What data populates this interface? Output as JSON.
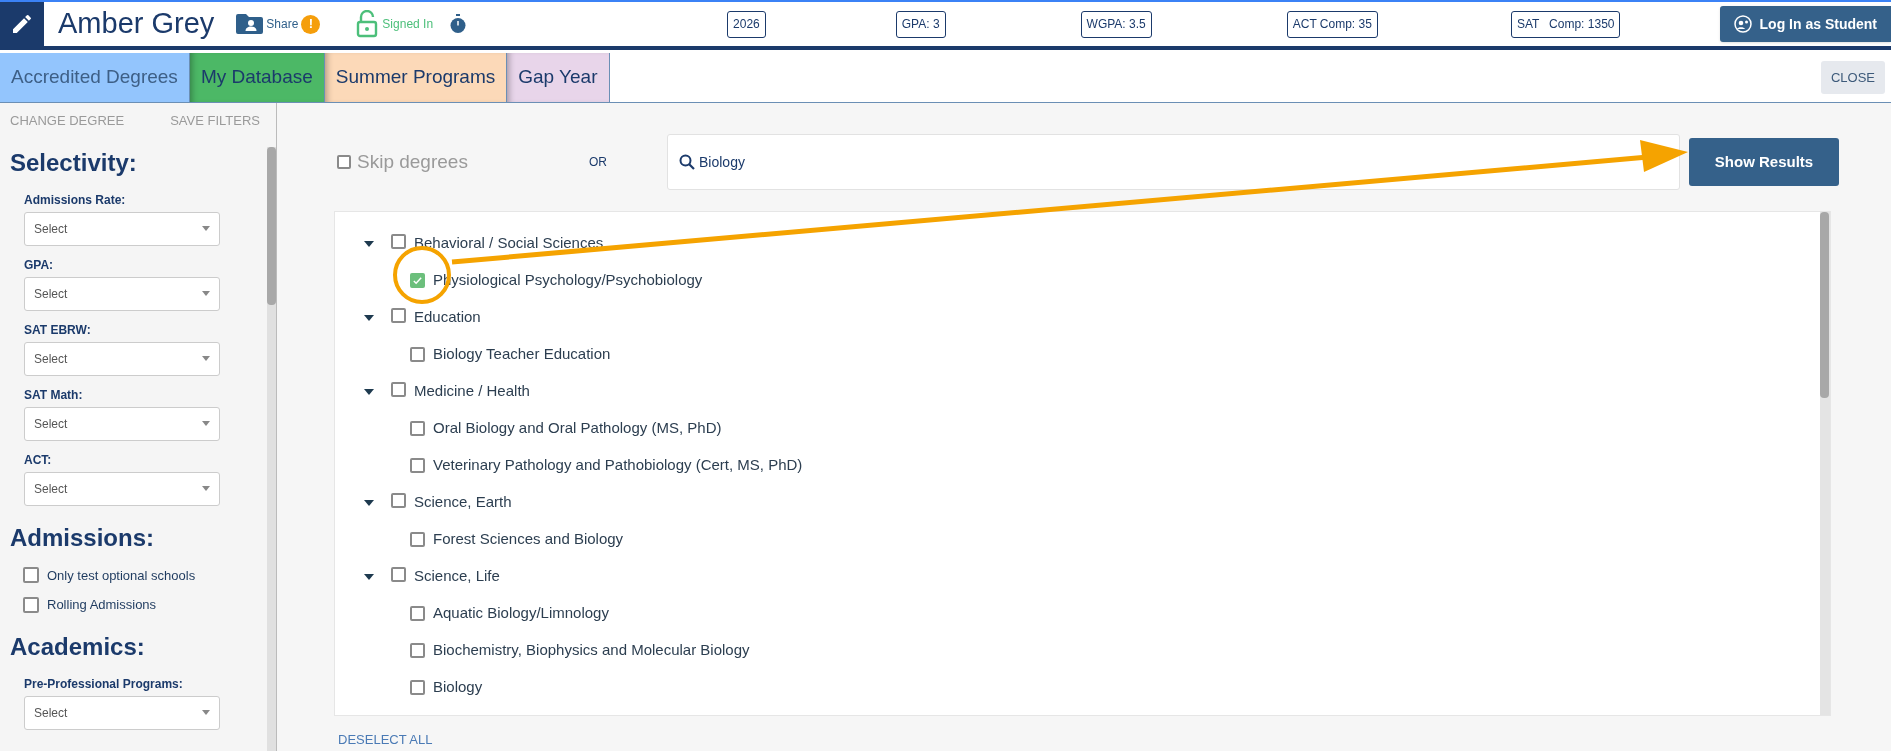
{
  "header": {
    "name": "Amber Grey",
    "share_label": "Share",
    "share_alert": "!",
    "signed_in_label": "Signed In",
    "stats": [
      "2026",
      "GPA: 3",
      "WGPA: 3.5",
      "ACT Comp: 35",
      "SAT   Comp: 1350"
    ],
    "login_button": "Log In as Student"
  },
  "tabs": [
    {
      "label": "Accredited Degrees",
      "color": "#93c5fd",
      "selected": true
    },
    {
      "label": "My Database",
      "color": "#4cb866",
      "selected": false
    },
    {
      "label": "Summer Programs",
      "color": "#fcd9b8",
      "selected": false
    },
    {
      "label": "Gap Year",
      "color": "#e8d5ea",
      "selected": false
    }
  ],
  "close_button": "CLOSE",
  "sidebar": {
    "links": [
      "CHANGE DEGREE",
      "SAVE FILTERS"
    ],
    "sections": [
      {
        "title": "Selectivity:",
        "kind": "selects",
        "filters": [
          {
            "label": "Admissions Rate:",
            "placeholder": "Select"
          },
          {
            "label": "GPA:",
            "placeholder": "Select"
          },
          {
            "label": "SAT EBRW:",
            "placeholder": "Select"
          },
          {
            "label": "SAT Math:",
            "placeholder": "Select"
          },
          {
            "label": "ACT:",
            "placeholder": "Select"
          }
        ]
      },
      {
        "title": "Admissions:",
        "kind": "checkboxes",
        "options": [
          {
            "label": "Only test optional schools",
            "checked": false
          },
          {
            "label": "Rolling Admissions",
            "checked": false
          }
        ]
      },
      {
        "title": "Academics:",
        "kind": "selects",
        "filters": [
          {
            "label": "Pre-Professional Programs:",
            "placeholder": "Select"
          }
        ]
      }
    ]
  },
  "main": {
    "skip_degrees": {
      "label": "Skip degrees",
      "checked": false
    },
    "or_label": "OR",
    "search": {
      "value": "Biology"
    },
    "show_results_button": "Show Results",
    "tree": [
      {
        "label": "Behavioral / Social Sciences",
        "checked": false,
        "expanded": true,
        "children": [
          {
            "label": "Physiological Psychology/Psychobiology",
            "checked": true
          }
        ]
      },
      {
        "label": "Education",
        "checked": false,
        "expanded": true,
        "children": [
          {
            "label": "Biology Teacher Education",
            "checked": false
          }
        ]
      },
      {
        "label": "Medicine / Health",
        "checked": false,
        "expanded": true,
        "children": [
          {
            "label": "Oral Biology and Oral Pathology (MS, PhD)",
            "checked": false
          },
          {
            "label": "Veterinary Pathology and Pathobiology (Cert, MS, PhD)",
            "checked": false
          }
        ]
      },
      {
        "label": "Science, Earth",
        "checked": false,
        "expanded": true,
        "children": [
          {
            "label": "Forest Sciences and Biology",
            "checked": false
          }
        ]
      },
      {
        "label": "Science, Life",
        "checked": false,
        "expanded": true,
        "children": [
          {
            "label": "Aquatic Biology/Limnology",
            "checked": false
          },
          {
            "label": "Biochemistry, Biophysics and Molecular Biology",
            "checked": false
          },
          {
            "label": "Biology",
            "checked": false
          }
        ]
      }
    ],
    "deselect_all": "DESELECT ALL"
  }
}
